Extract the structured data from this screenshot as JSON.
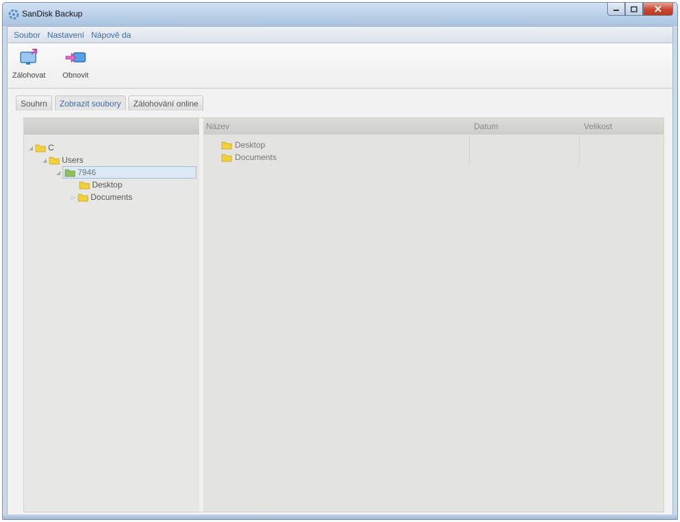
{
  "window": {
    "title": "SanDisk Backup"
  },
  "menu": [
    "Soubor",
    "Nastavení",
    "Nápově da"
  ],
  "toolbar": {
    "backup_label": "Zálohovat",
    "restore_label": "Obnovit"
  },
  "tabs": [
    "Souhrn",
    "Zobrazit soubory",
    "Zálohování online"
  ],
  "tree": {
    "nodes": [
      {
        "label": "C"
      },
      {
        "label": "Users"
      },
      {
        "label": "7946",
        "selected": true
      },
      {
        "label": "Desktop"
      },
      {
        "label": "Documents"
      }
    ]
  },
  "list": {
    "columns": [
      "Název",
      "Datum",
      "Velikost"
    ],
    "rows": [
      {
        "name": "Desktop",
        "date": "",
        "size": ""
      },
      {
        "name": "Documents",
        "date": "",
        "size": ""
      }
    ]
  },
  "colors": {
    "accent": "#3c6ca8",
    "folder": "#f2d03b",
    "selection": "#dde8f5"
  }
}
